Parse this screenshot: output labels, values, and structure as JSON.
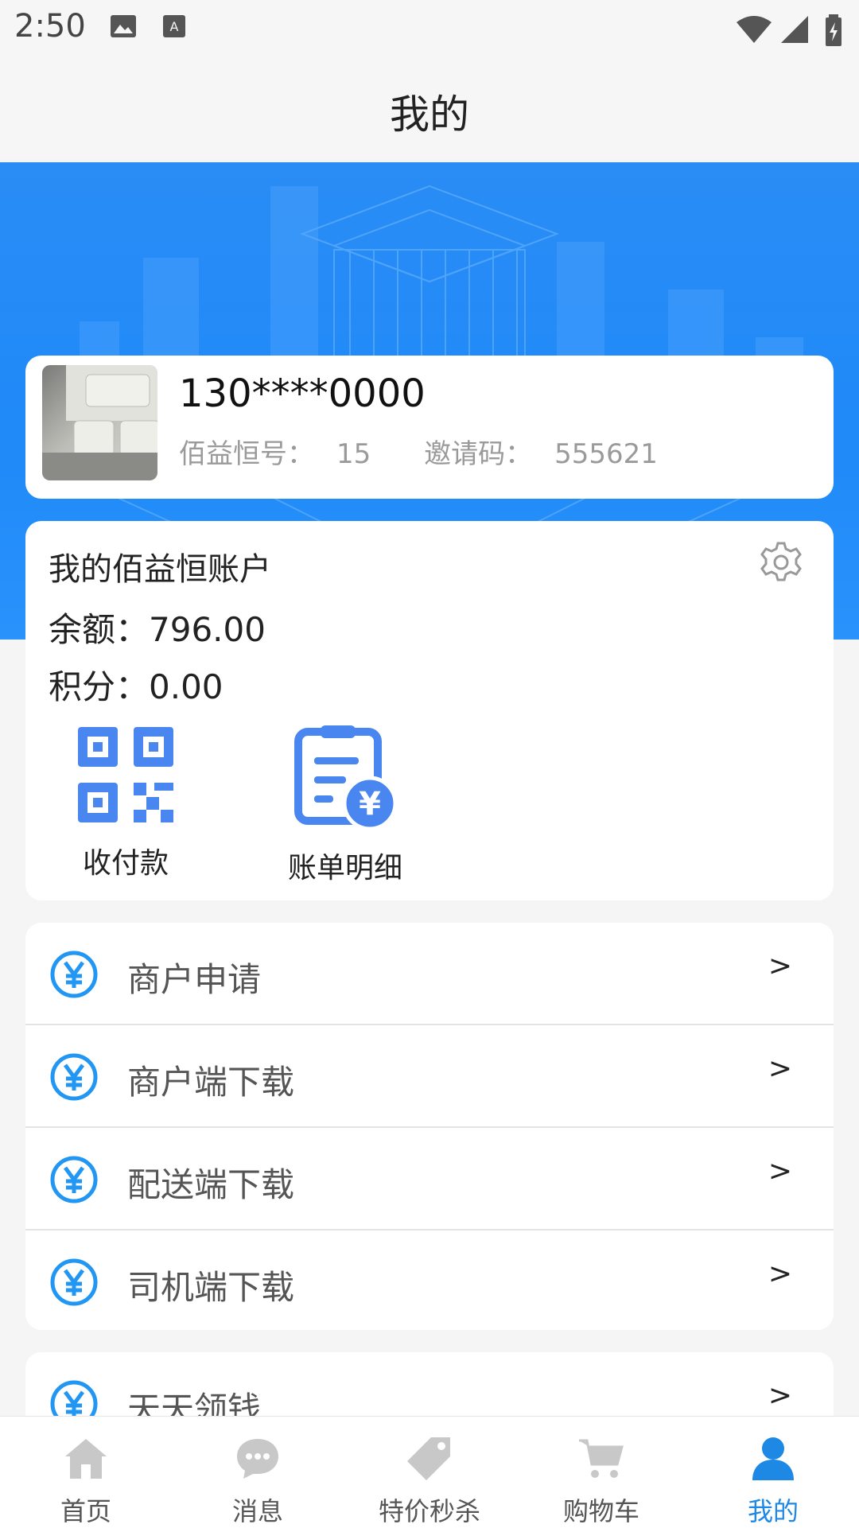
{
  "status_bar": {
    "time": "2:50"
  },
  "header": {
    "title": "我的"
  },
  "profile": {
    "phone": "130****0000",
    "member_no_label": "佰益恒号：",
    "member_no": "15",
    "invite_label": "邀请码：",
    "invite_code": "555621"
  },
  "account": {
    "title": "我的佰益恒账户",
    "balance_label": "余额：",
    "balance": "796.00",
    "points_label": "积分：",
    "points": "0.00",
    "actions": [
      {
        "label": "收付款",
        "icon": "qr-code-icon"
      },
      {
        "label": "账单明细",
        "icon": "bill-icon"
      }
    ]
  },
  "menu": [
    {
      "label": "商户申请",
      "icon": "yuan-icon",
      "arrow": ">"
    },
    {
      "label": "商户端下载",
      "icon": "yuan-icon",
      "arrow": ">"
    },
    {
      "label": "配送端下载",
      "icon": "yuan-icon",
      "arrow": ">"
    },
    {
      "label": "司机端下载",
      "icon": "yuan-icon",
      "arrow": ">"
    }
  ],
  "menu2": [
    {
      "label": "天天领钱",
      "icon": "yuan-icon",
      "arrow": ">"
    }
  ],
  "tabs": [
    {
      "label": "首页",
      "icon": "home-icon"
    },
    {
      "label": "消息",
      "icon": "message-icon"
    },
    {
      "label": "特价秒杀",
      "icon": "tag-icon"
    },
    {
      "label": "购物车",
      "icon": "cart-icon"
    },
    {
      "label": "我的",
      "icon": "user-icon",
      "active": true
    }
  ],
  "colors": {
    "accent": "#1e88e5",
    "banner": "#1f8af8",
    "icon_blue": "#4a86f0"
  }
}
